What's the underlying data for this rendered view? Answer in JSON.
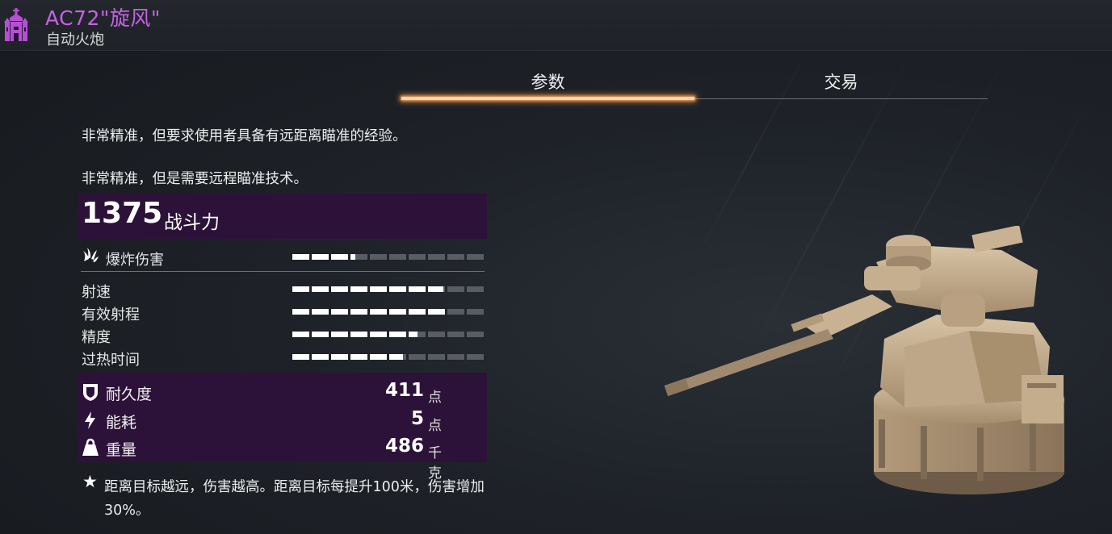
{
  "header": {
    "item_name": "AC72\"旋风\"",
    "item_type": "自动火炮",
    "class_icon": "purple-castle-icon"
  },
  "tabs": [
    {
      "label": "参数",
      "active": true
    },
    {
      "label": "交易",
      "active": false
    }
  ],
  "descriptions": [
    "非常精准，但要求使用者具备有远距离瞄准的经验。",
    "非常精准，但是需要远程瞄准技术。"
  ],
  "power": {
    "value": "1375",
    "label": "战斗力"
  },
  "stats": [
    {
      "label": "爆炸伤害",
      "icon": "explosion-icon",
      "level": 0.33
    },
    {
      "label": "射速",
      "level": 0.79
    },
    {
      "label": "有效射程",
      "level": 0.8
    },
    {
      "label": "精度",
      "level": 0.65
    },
    {
      "label": "过热时间",
      "level": 0.58
    }
  ],
  "resources": [
    {
      "label": "耐久度",
      "icon": "shield-icon",
      "value": "411",
      "unit": "点"
    },
    {
      "label": "能耗",
      "icon": "lightning-icon",
      "value": "5",
      "unit": "点"
    },
    {
      "label": "重量",
      "icon": "weight-icon",
      "value": "486",
      "unit": "千克"
    }
  ],
  "note": {
    "icon": "star-icon",
    "text": "距离目标越远，伤害越高。距离目标每提升100米，伤害增加30%。"
  },
  "colors": {
    "accent_purple": "#c662e6",
    "panel_purple": "#2c1238",
    "tab_glow": "#ff9a3c"
  }
}
